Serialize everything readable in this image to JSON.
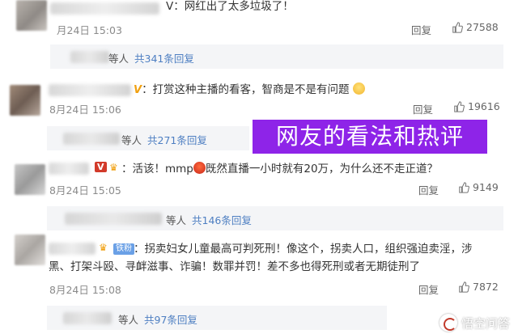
{
  "overlay_title": "网友的看法和热评",
  "watermark": "悟空问答",
  "comments": [
    {
      "text": "V：网红出了太多垃圾了！",
      "time": "月24日 15:03",
      "reply_label": "回复",
      "likes": "27588",
      "replies": {
        "prefix": "等人",
        "count_label": "共341条回复"
      }
    },
    {
      "text": "：打赏这种主播的看客，智商是不是有问题",
      "time": "8月24日 15:06",
      "reply_label": "回复",
      "likes": "19616",
      "replies": {
        "prefix": "等人",
        "count_label": "共271条回复"
      }
    },
    {
      "text_before": "：活该！mmp",
      "text_after": "既然直播一小时就有20万，为什么还不走正道？",
      "time": "8月24日 15:05",
      "reply_label": "回复",
      "likes": "9149",
      "replies": {
        "prefix": "等人",
        "count_label": "共146条回复"
      }
    },
    {
      "badge": "铁粉",
      "line1": "：拐卖妇女儿童最高可判死刑！像这个，拐卖人口，组织强迫卖淫，涉",
      "line2": "黑、打架斗殴、寻衅滋事、诈骗！数罪并罚！差不多也得死刑或者无期徒刑了",
      "time": "8月24日 15:08",
      "reply_label": "回复",
      "likes": "7872",
      "replies": {
        "prefix": "等人",
        "count_label": "共97条回复"
      }
    }
  ],
  "colors": {
    "overlay_bg": "#8e24e8",
    "link_blue": "#4e7fc2",
    "vip_blue": "#3d8fe0",
    "vip_gold": "#f0a010",
    "reply_bg": "#f4f5f7"
  },
  "icons": [
    "thumbs-up-icon",
    "vip-v-icon",
    "emoji-icon",
    "wukong-logo-icon"
  ]
}
